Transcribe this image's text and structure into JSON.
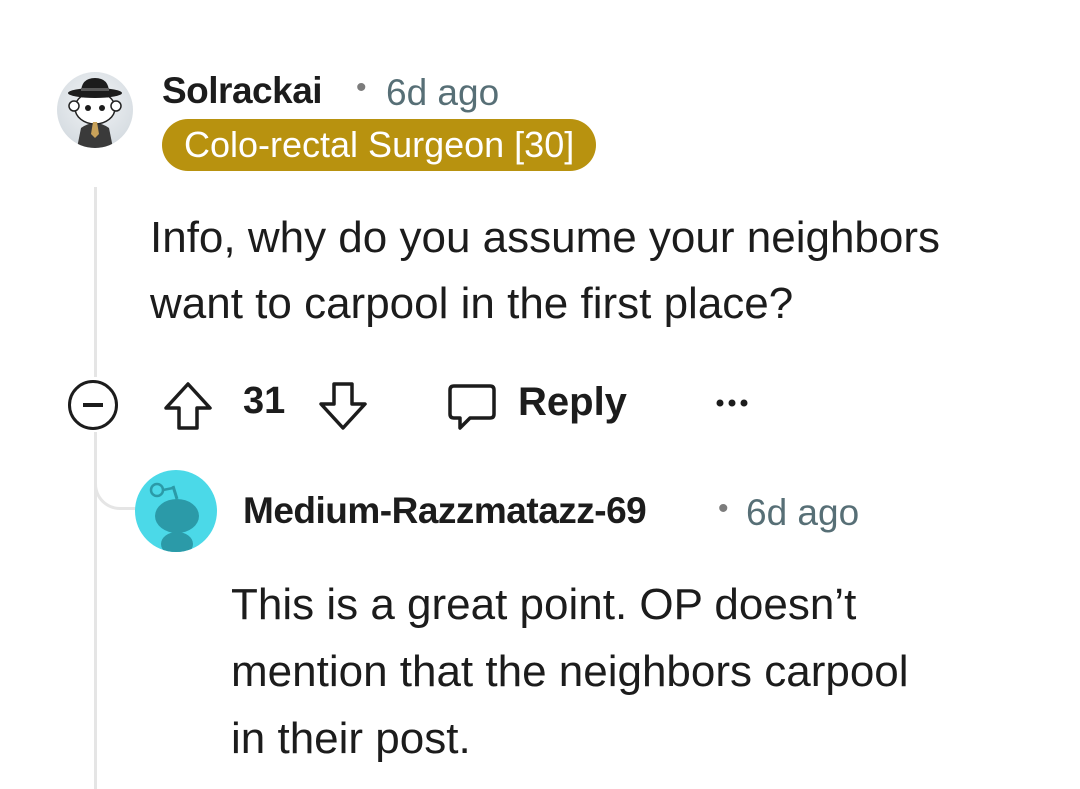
{
  "comment": {
    "username": "Solrackai",
    "separator": "•",
    "time": "6d ago",
    "flair": "Colo-rectal Surgeon [30]",
    "flair_color": "#b8920f",
    "body_lines": [
      "Info, why do you assume your neighbors",
      "want to carpool in the first place?"
    ],
    "score": "31",
    "reply_label": "Reply",
    "more_label": "•••"
  },
  "reply": {
    "username": "Medium-Razzmatazz-69",
    "separator": "•",
    "time": "6d ago",
    "avatar_color": "#4bd9e8",
    "body_lines": [
      "This is a great point. OP doesn’t",
      "mention that the neighbors carpool",
      "in their post."
    ]
  }
}
